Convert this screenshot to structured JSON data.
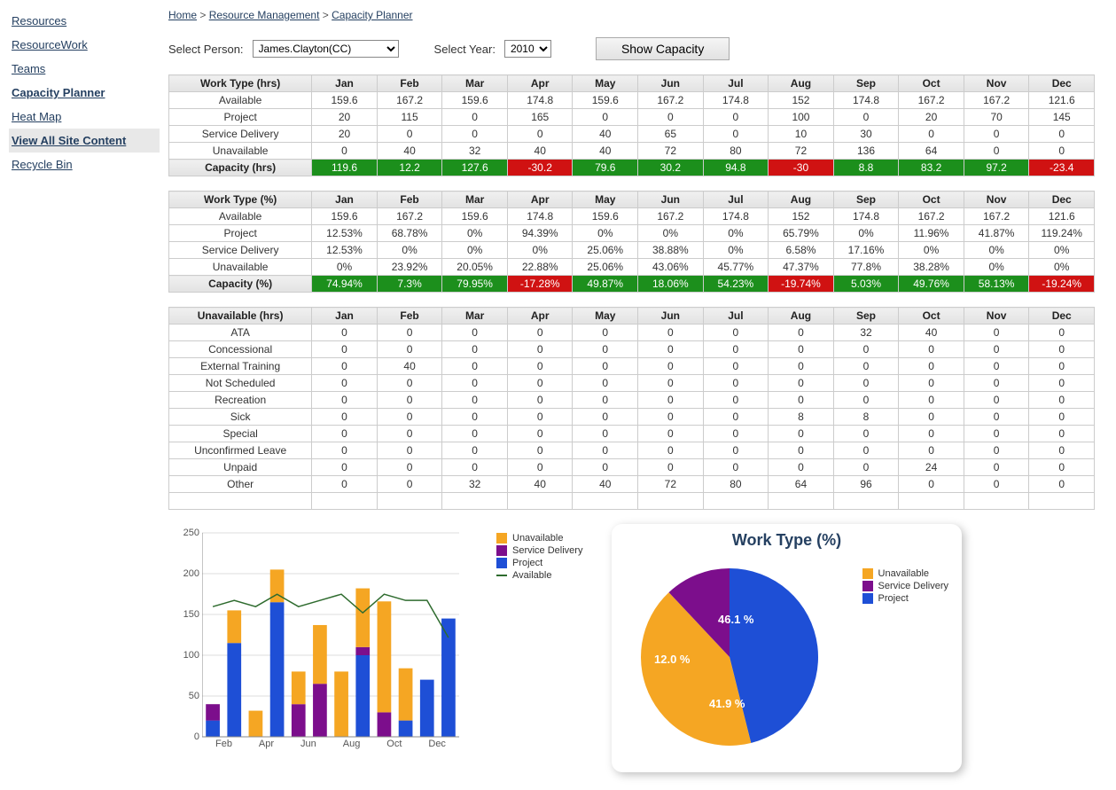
{
  "breadcrumb": {
    "home": "Home",
    "rm": "Resource Management",
    "cp": "Capacity Planner",
    "sep": " > "
  },
  "sidebar": {
    "items": [
      {
        "label": "Resources"
      },
      {
        "label": "ResourceWork"
      },
      {
        "label": "Teams"
      },
      {
        "label": "Capacity Planner"
      },
      {
        "label": "Heat Map"
      },
      {
        "label": "View All Site Content"
      },
      {
        "label": " Recycle Bin"
      }
    ]
  },
  "controls": {
    "person_label": "Select Person:",
    "person_value": "James.Clayton(CC)",
    "year_label": "Select Year:",
    "year_value": "2010",
    "button": "Show Capacity"
  },
  "months": [
    "Jan",
    "Feb",
    "Mar",
    "Apr",
    "May",
    "Jun",
    "Jul",
    "Aug",
    "Sep",
    "Oct",
    "Nov",
    "Dec"
  ],
  "tables": {
    "hrs": {
      "header0": "Work Type (hrs)",
      "rows": [
        {
          "label": "Available",
          "v": [
            "159.6",
            "167.2",
            "159.6",
            "174.8",
            "159.6",
            "167.2",
            "174.8",
            "152",
            "174.8",
            "167.2",
            "167.2",
            "121.6"
          ]
        },
        {
          "label": "Project",
          "v": [
            "20",
            "115",
            "0",
            "165",
            "0",
            "0",
            "0",
            "100",
            "0",
            "20",
            "70",
            "145"
          ]
        },
        {
          "label": "Service Delivery",
          "v": [
            "20",
            "0",
            "0",
            "0",
            "40",
            "65",
            "0",
            "10",
            "30",
            "0",
            "0",
            "0"
          ]
        },
        {
          "label": "Unavailable",
          "v": [
            "0",
            "40",
            "32",
            "40",
            "40",
            "72",
            "80",
            "72",
            "136",
            "64",
            "0",
            "0"
          ]
        }
      ],
      "capacity": {
        "label": "Capacity (hrs)",
        "v": [
          "119.6",
          "12.2",
          "127.6",
          "-30.2",
          "79.6",
          "30.2",
          "94.8",
          "-30",
          "8.8",
          "83.2",
          "97.2",
          "-23.4"
        ]
      }
    },
    "pct": {
      "header0": "Work Type (%)",
      "rows": [
        {
          "label": "Available",
          "v": [
            "159.6",
            "167.2",
            "159.6",
            "174.8",
            "159.6",
            "167.2",
            "174.8",
            "152",
            "174.8",
            "167.2",
            "167.2",
            "121.6"
          ]
        },
        {
          "label": "Project",
          "v": [
            "12.53%",
            "68.78%",
            "0%",
            "94.39%",
            "0%",
            "0%",
            "0%",
            "65.79%",
            "0%",
            "11.96%",
            "41.87%",
            "119.24%"
          ]
        },
        {
          "label": "Service Delivery",
          "v": [
            "12.53%",
            "0%",
            "0%",
            "0%",
            "25.06%",
            "38.88%",
            "0%",
            "6.58%",
            "17.16%",
            "0%",
            "0%",
            "0%"
          ]
        },
        {
          "label": "Unavailable",
          "v": [
            "0%",
            "23.92%",
            "20.05%",
            "22.88%",
            "25.06%",
            "43.06%",
            "45.77%",
            "47.37%",
            "77.8%",
            "38.28%",
            "0%",
            "0%"
          ]
        }
      ],
      "capacity": {
        "label": "Capacity (%)",
        "v": [
          "74.94%",
          "7.3%",
          "79.95%",
          "-17.28%",
          "49.87%",
          "18.06%",
          "54.23%",
          "-19.74%",
          "5.03%",
          "49.76%",
          "58.13%",
          "-19.24%"
        ]
      }
    },
    "unavail": {
      "header0": "Unavailable (hrs)",
      "rows": [
        {
          "label": "ATA",
          "v": [
            "0",
            "0",
            "0",
            "0",
            "0",
            "0",
            "0",
            "0",
            "32",
            "40",
            "0",
            "0"
          ]
        },
        {
          "label": "Concessional",
          "v": [
            "0",
            "0",
            "0",
            "0",
            "0",
            "0",
            "0",
            "0",
            "0",
            "0",
            "0",
            "0"
          ]
        },
        {
          "label": "External Training",
          "v": [
            "0",
            "40",
            "0",
            "0",
            "0",
            "0",
            "0",
            "0",
            "0",
            "0",
            "0",
            "0"
          ]
        },
        {
          "label": "Not Scheduled",
          "v": [
            "0",
            "0",
            "0",
            "0",
            "0",
            "0",
            "0",
            "0",
            "0",
            "0",
            "0",
            "0"
          ]
        },
        {
          "label": "Recreation",
          "v": [
            "0",
            "0",
            "0",
            "0",
            "0",
            "0",
            "0",
            "0",
            "0",
            "0",
            "0",
            "0"
          ]
        },
        {
          "label": "Sick",
          "v": [
            "0",
            "0",
            "0",
            "0",
            "0",
            "0",
            "0",
            "8",
            "8",
            "0",
            "0",
            "0"
          ]
        },
        {
          "label": "Special",
          "v": [
            "0",
            "0",
            "0",
            "0",
            "0",
            "0",
            "0",
            "0",
            "0",
            "0",
            "0",
            "0"
          ]
        },
        {
          "label": "Unconfirmed Leave",
          "v": [
            "0",
            "0",
            "0",
            "0",
            "0",
            "0",
            "0",
            "0",
            "0",
            "0",
            "0",
            "0"
          ]
        },
        {
          "label": "Unpaid",
          "v": [
            "0",
            "0",
            "0",
            "0",
            "0",
            "0",
            "0",
            "0",
            "0",
            "24",
            "0",
            "0"
          ]
        },
        {
          "label": "Other",
          "v": [
            "0",
            "0",
            "32",
            "40",
            "40",
            "72",
            "80",
            "64",
            "96",
            "0",
            "0",
            "0"
          ]
        }
      ]
    }
  },
  "chart_data": [
    {
      "type": "bar",
      "categories": [
        "Jan",
        "Feb",
        "Mar",
        "Apr",
        "May",
        "Jun",
        "Jul",
        "Aug",
        "Sep",
        "Oct",
        "Nov",
        "Dec"
      ],
      "series": [
        {
          "name": "Unavailable",
          "color": "#F5A623",
          "values": [
            0,
            40,
            32,
            40,
            40,
            72,
            80,
            72,
            136,
            64,
            0,
            0
          ]
        },
        {
          "name": "Service Delivery",
          "color": "#7C0E8C",
          "values": [
            20,
            0,
            0,
            0,
            40,
            65,
            0,
            10,
            30,
            0,
            0,
            0
          ]
        },
        {
          "name": "Project",
          "color": "#1E4FD6",
          "values": [
            20,
            115,
            0,
            165,
            0,
            0,
            0,
            100,
            0,
            20,
            70,
            145
          ]
        },
        {
          "name": "Available",
          "color": "#2E6B2E",
          "values": [
            159.6,
            167.2,
            159.6,
            174.8,
            159.6,
            167.2,
            174.8,
            152,
            174.8,
            167.2,
            167.2,
            121.6
          ],
          "kind": "line"
        }
      ],
      "ylim": [
        0,
        250
      ],
      "xlabel": "",
      "ylabel": "",
      "title": ""
    },
    {
      "type": "pie",
      "title": "Work Type (%)",
      "series": [
        {
          "name": "Unavailable",
          "value": 41.9,
          "color": "#F5A623"
        },
        {
          "name": "Service Delivery",
          "value": 12.0,
          "color": "#7C0E8C"
        },
        {
          "name": "Project",
          "value": 46.1,
          "color": "#1E4FD6"
        }
      ]
    }
  ],
  "legend": {
    "bar": [
      "Unavailable",
      "Service Delivery",
      "Project",
      "Available"
    ],
    "pie": [
      "Unavailable",
      "Service Delivery",
      "Project"
    ]
  },
  "pie_labels": {
    "p1": "46.1 %",
    "p2": "12.0 %",
    "p3": "41.9 %"
  },
  "ylabels": [
    "0",
    "50",
    "100",
    "150",
    "200",
    "250"
  ],
  "xaxis_labels": [
    "Feb",
    "Apr",
    "Jun",
    "Aug",
    "Oct",
    "Dec"
  ]
}
